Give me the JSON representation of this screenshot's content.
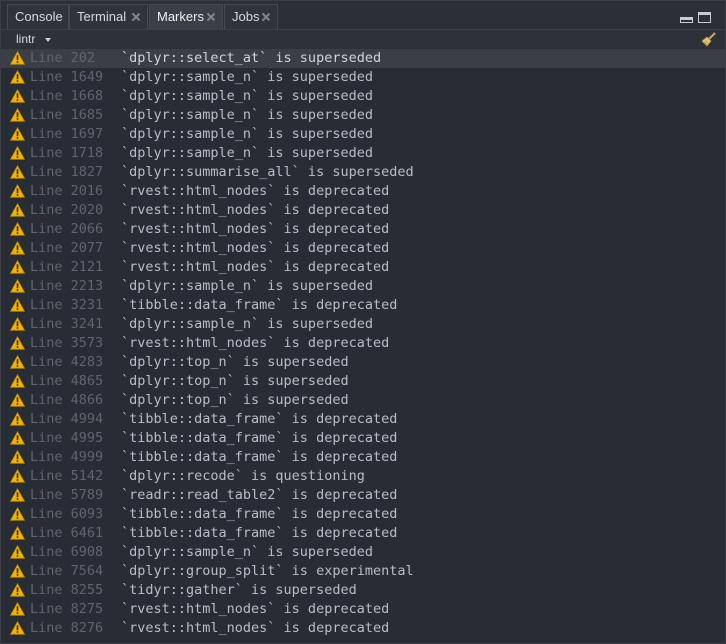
{
  "tabs": [
    {
      "label": "Console",
      "active": false,
      "closable": false
    },
    {
      "label": "Terminal",
      "active": false,
      "closable": true
    },
    {
      "label": "Markers",
      "active": true,
      "closable": true
    },
    {
      "label": "Jobs",
      "active": false,
      "closable": true
    }
  ],
  "toolbar": {
    "source_label": "lintr",
    "clear_icon": "broom-icon"
  },
  "colors": {
    "background": "#282c34",
    "warning": "#f5b400",
    "line_text": "#5f6570",
    "message_text": "#b8bec8"
  },
  "markers": [
    {
      "line": "Line 202",
      "message": "`dplyr::select_at` is superseded",
      "selected": true
    },
    {
      "line": "Line 1649",
      "message": "`dplyr::sample_n` is superseded"
    },
    {
      "line": "Line 1668",
      "message": "`dplyr::sample_n` is superseded"
    },
    {
      "line": "Line 1685",
      "message": "`dplyr::sample_n` is superseded"
    },
    {
      "line": "Line 1697",
      "message": "`dplyr::sample_n` is superseded"
    },
    {
      "line": "Line 1718",
      "message": "`dplyr::sample_n` is superseded"
    },
    {
      "line": "Line 1827",
      "message": "`dplyr::summarise_all` is superseded"
    },
    {
      "line": "Line 2016",
      "message": "`rvest::html_nodes` is deprecated"
    },
    {
      "line": "Line 2020",
      "message": "`rvest::html_nodes` is deprecated"
    },
    {
      "line": "Line 2066",
      "message": "`rvest::html_nodes` is deprecated"
    },
    {
      "line": "Line 2077",
      "message": "`rvest::html_nodes` is deprecated"
    },
    {
      "line": "Line 2121",
      "message": "`rvest::html_nodes` is deprecated"
    },
    {
      "line": "Line 2213",
      "message": "`dplyr::sample_n` is superseded"
    },
    {
      "line": "Line 3231",
      "message": "`tibble::data_frame` is deprecated"
    },
    {
      "line": "Line 3241",
      "message": "`dplyr::sample_n` is superseded"
    },
    {
      "line": "Line 3573",
      "message": "`rvest::html_nodes` is deprecated"
    },
    {
      "line": "Line 4283",
      "message": "`dplyr::top_n` is superseded"
    },
    {
      "line": "Line 4865",
      "message": "`dplyr::top_n` is superseded"
    },
    {
      "line": "Line 4866",
      "message": "`dplyr::top_n` is superseded"
    },
    {
      "line": "Line 4994",
      "message": "`tibble::data_frame` is deprecated"
    },
    {
      "line": "Line 4995",
      "message": "`tibble::data_frame` is deprecated"
    },
    {
      "line": "Line 4999",
      "message": "`tibble::data_frame` is deprecated"
    },
    {
      "line": "Line 5142",
      "message": "`dplyr::recode` is questioning"
    },
    {
      "line": "Line 5789",
      "message": "`readr::read_table2` is deprecated"
    },
    {
      "line": "Line 6093",
      "message": "`tibble::data_frame` is deprecated"
    },
    {
      "line": "Line 6461",
      "message": "`tibble::data_frame` is deprecated"
    },
    {
      "line": "Line 6908",
      "message": "`dplyr::sample_n` is superseded"
    },
    {
      "line": "Line 7564",
      "message": "`dplyr::group_split` is experimental"
    },
    {
      "line": "Line 8255",
      "message": "`tidyr::gather` is superseded"
    },
    {
      "line": "Line 8275",
      "message": "`rvest::html_nodes` is deprecated"
    },
    {
      "line": "Line 8276",
      "message": "`rvest::html_nodes` is deprecated"
    }
  ]
}
